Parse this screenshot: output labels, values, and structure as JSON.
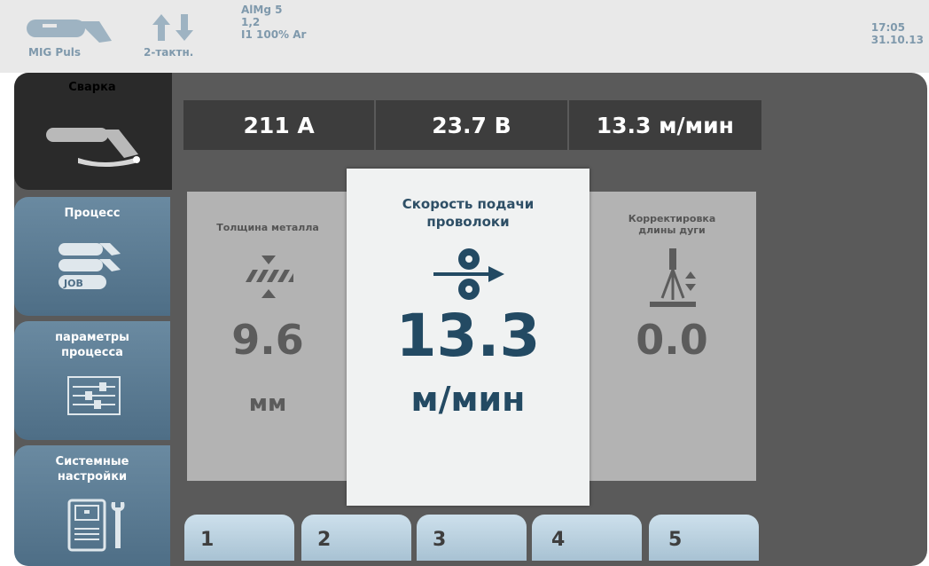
{
  "statusbar": {
    "process": "MIG Puls",
    "mode": "2-тактн.",
    "material": "AlMg 5",
    "wire_diameter": "1,2",
    "gas": "I1 100% Ar",
    "time": "17:05",
    "date": "31.10.13"
  },
  "sidebar": {
    "items": [
      {
        "label": "Сварка",
        "icon": "welding-torch-icon",
        "active": true
      },
      {
        "label": "Процесс",
        "icon": "process-job-icon",
        "active": false
      },
      {
        "label_line1": "параметры",
        "label_line2": "процесса",
        "icon": "sliders-icon",
        "active": false
      },
      {
        "label_line1": "Системные",
        "label_line2": "настройки",
        "icon": "machine-wrench-icon",
        "active": false
      }
    ]
  },
  "readouts": {
    "current": "211 A",
    "voltage": "23.7 B",
    "wire_speed": "13.3 м/мин"
  },
  "params": {
    "left": {
      "label": "Толщина металла",
      "value": "9.6",
      "unit": "мм",
      "icon": "metal-thickness-icon"
    },
    "center": {
      "label_line1": "Скорость подачи",
      "label_line2": "проволоки",
      "value": "13.3",
      "unit": "м/мин",
      "icon": "wire-feed-icon"
    },
    "right": {
      "label_line1": "Корректировка",
      "label_line2": "длины дуги",
      "value": "0.0",
      "icon": "arc-length-icon"
    }
  },
  "function_buttons": [
    "1",
    "2",
    "3",
    "4",
    "5"
  ],
  "colors": {
    "accent_blue": "#234a63",
    "tab_blue": "#5a7a92",
    "panel_dark": "#5a5a5a",
    "statusbar_text": "#7f99ac"
  }
}
